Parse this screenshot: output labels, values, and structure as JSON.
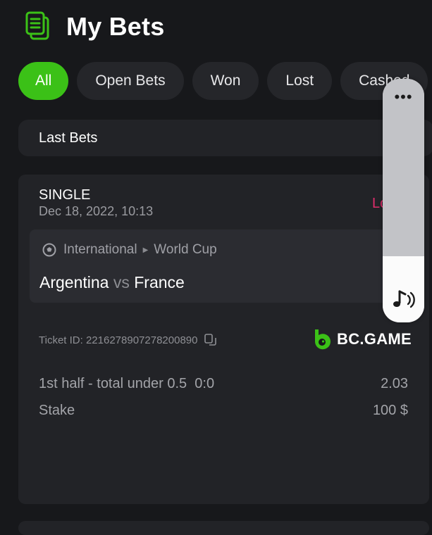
{
  "page": {
    "title": "My Bets"
  },
  "filters": [
    {
      "label": "All",
      "active": true
    },
    {
      "label": "Open Bets",
      "active": false
    },
    {
      "label": "Won",
      "active": false
    },
    {
      "label": "Lost",
      "active": false
    },
    {
      "label": "Cashed",
      "active": false
    }
  ],
  "section": {
    "title": "Last Bets"
  },
  "bet": {
    "type": "SINGLE",
    "date": "Dec 18, 2022, 10:13",
    "status": "Lost",
    "league": "International",
    "tournament": "World Cup",
    "home": "Argentina",
    "vs": "vs",
    "away": "France",
    "ticket_label": "Ticket ID:",
    "ticket_id": "2216278907278200890",
    "brand": "BC.GAME",
    "selection": "1st half - total under 0.5",
    "selection_score": "0:0",
    "odds": "2.03",
    "stake_label": "Stake",
    "stake_value": "100 $"
  },
  "overlay": {
    "menu": "•••"
  },
  "colors": {
    "accent": "#3bc117",
    "lost": "#e02d6b",
    "background": "#17181b",
    "card": "#222327"
  }
}
